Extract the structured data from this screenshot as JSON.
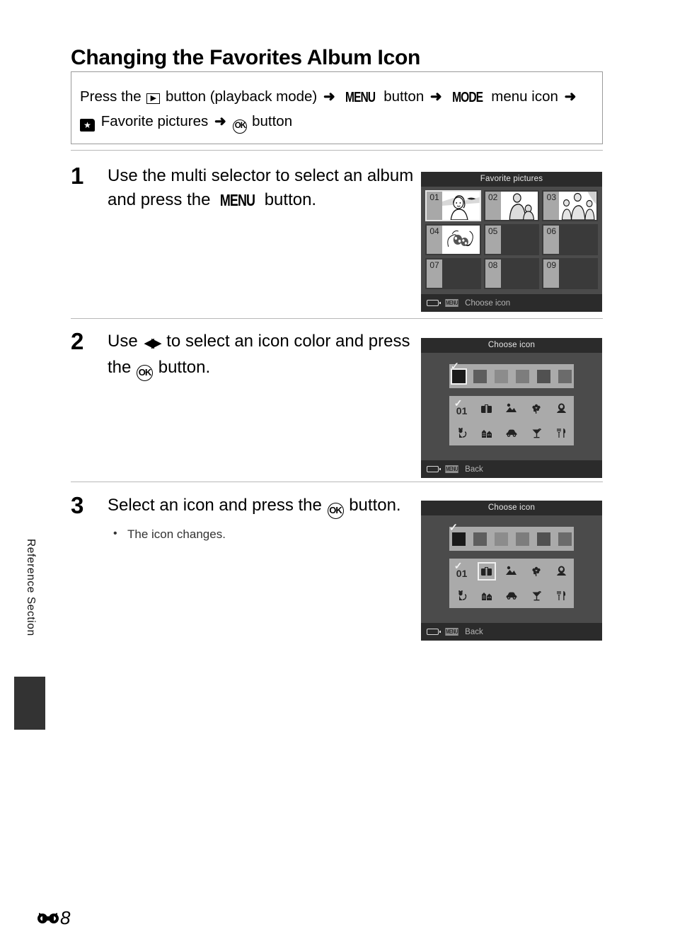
{
  "page": {
    "title": "Changing the Favorites Album Icon",
    "side_tab_label": "Reference Section",
    "footer_ref_glyph": "E",
    "footer_page_number": "8"
  },
  "path_box": {
    "line1_a": "Press the",
    "icon_playback": "play-icon",
    "line1_b": "button (playback mode)",
    "arrow": "➜",
    "menu_label": "MENU",
    "line1_c": "button",
    "mode_label": "MODE",
    "line1_d": "menu icon",
    "favorites_icon": "★",
    "line2_a": "Favorite pictures",
    "ok_label": "OK",
    "line2_b": "button"
  },
  "steps": [
    {
      "number": "1",
      "text_before": "Use the multi selector to select an album and press the",
      "inline_glyph": "MENU",
      "text_after": "button.",
      "bullets": []
    },
    {
      "number": "2",
      "text_before": "Use",
      "inline_glyph": "◀▶",
      "text_mid": "to select an icon color and press the",
      "inline_glyph2": "OK",
      "text_after": "button.",
      "bullets": []
    },
    {
      "number": "3",
      "text_before": "Select an icon and press the",
      "inline_glyph": "OK",
      "text_after": "button.",
      "bullets": [
        "The icon changes."
      ]
    }
  ],
  "screens": {
    "favorite_pictures": {
      "title": "Favorite pictures",
      "footer_badge": "MENU",
      "footer_text": "Choose icon",
      "battery_icon": "battery-icon",
      "cells": [
        {
          "num": "01",
          "thumb": "woman-landscape",
          "selected": true
        },
        {
          "num": "02",
          "thumb": "woman-child",
          "selected": false
        },
        {
          "num": "03",
          "thumb": "family-three",
          "selected": false
        },
        {
          "num": "04",
          "thumb": "flowers",
          "selected": false
        },
        {
          "num": "05",
          "thumb": "",
          "selected": false
        },
        {
          "num": "06",
          "thumb": "",
          "selected": false
        },
        {
          "num": "07",
          "thumb": "",
          "selected": false
        },
        {
          "num": "08",
          "thumb": "",
          "selected": false
        },
        {
          "num": "09",
          "thumb": "",
          "selected": false
        }
      ]
    },
    "choose_icon_step2": {
      "title": "Choose icon",
      "footer_badge": "MENU",
      "footer_text": "Back",
      "battery_icon": "battery-icon",
      "selection": "color",
      "selected_color_index": 0,
      "selected_icon_index": -1,
      "colors": [
        "#1a1a1a",
        "#5e5e5e",
        "#8c8c8c",
        "#7d7d7d",
        "#515151",
        "#6b6b6b"
      ],
      "icons": [
        {
          "name": "album-number-01",
          "glyph": "01"
        },
        {
          "name": "briefcase-icon",
          "glyph": "briefcase"
        },
        {
          "name": "landscape-icon",
          "glyph": "landscape"
        },
        {
          "name": "flower-icon",
          "glyph": "flower"
        },
        {
          "name": "portrait-icon",
          "glyph": "portrait"
        },
        {
          "name": "cat-icon",
          "glyph": "cat"
        },
        {
          "name": "buildings-icon",
          "glyph": "buildings"
        },
        {
          "name": "car-icon",
          "glyph": "car"
        },
        {
          "name": "cocktail-icon",
          "glyph": "cocktail"
        },
        {
          "name": "cutlery-icon",
          "glyph": "cutlery"
        }
      ]
    },
    "choose_icon_step3": {
      "title": "Choose icon",
      "footer_badge": "MENU",
      "footer_text": "Back",
      "battery_icon": "battery-icon",
      "selection": "icon",
      "selected_color_index": -1,
      "selected_icon_index": 1,
      "colors": [
        "#1a1a1a",
        "#5e5e5e",
        "#8c8c8c",
        "#7d7d7d",
        "#515151",
        "#6b6b6b"
      ],
      "icons": [
        {
          "name": "album-number-01",
          "glyph": "01"
        },
        {
          "name": "briefcase-icon",
          "glyph": "briefcase"
        },
        {
          "name": "landscape-icon",
          "glyph": "landscape"
        },
        {
          "name": "flower-icon",
          "glyph": "flower"
        },
        {
          "name": "portrait-icon",
          "glyph": "portrait"
        },
        {
          "name": "cat-icon",
          "glyph": "cat"
        },
        {
          "name": "buildings-icon",
          "glyph": "buildings"
        },
        {
          "name": "car-icon",
          "glyph": "car"
        },
        {
          "name": "cocktail-icon",
          "glyph": "cocktail"
        },
        {
          "name": "cutlery-icon",
          "glyph": "cutlery"
        }
      ]
    }
  },
  "colors": {
    "lcd_bg": "#4b4b4b",
    "lcd_bar": "#2b2b2b",
    "panel": "#aaaaaa",
    "divider": "#b8b8b8",
    "side_block": "#333333"
  }
}
